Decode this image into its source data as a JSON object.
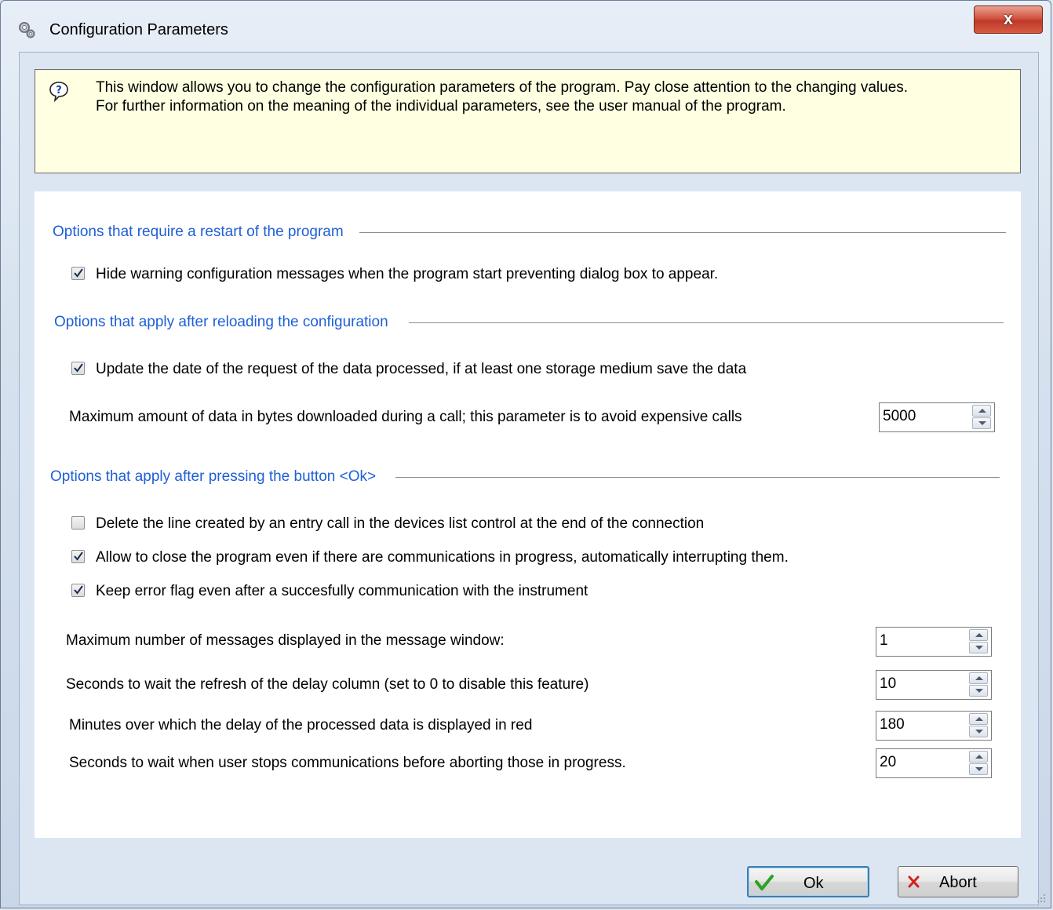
{
  "window": {
    "title": "Configuration Parameters",
    "close_label": "x"
  },
  "info": {
    "text": "This window allows you to change the configuration parameters of the program. Pay close attention to the changing values.\nFor further information on the meaning of the individual parameters, see the user manual of the program."
  },
  "groups": {
    "restart": {
      "title": "Options that require a restart of the program"
    },
    "reload": {
      "title": "Options that apply after reloading the configuration"
    },
    "ok": {
      "title": "Options that apply after pressing the button <Ok>"
    }
  },
  "options": {
    "hide_warnings": {
      "label": "Hide warning configuration  messages when the program start preventing dialog box to appear.",
      "checked": true
    },
    "update_date": {
      "label": "Update the date of the request of the data processed, if at least one storage medium save the data",
      "checked": true
    },
    "max_bytes": {
      "label": "Maximum amount of data in bytes downloaded during a call; this parameter is to avoid expensive calls",
      "value": "5000"
    },
    "delete_line": {
      "label": "Delete the line created by an entry call in the devices list control at the end of the connection",
      "checked": false
    },
    "allow_close": {
      "label": "Allow to close the program even if there are communications in progress, automatically interrupting them.",
      "checked": true
    },
    "keep_error": {
      "label": "Keep error flag even after a succesfully communication with the instrument",
      "checked": true
    },
    "max_messages": {
      "label": "Maximum number of messages displayed in the message window:",
      "value": "1"
    },
    "refresh_delay": {
      "label": "Seconds to wait the refresh of the delay column (set to 0 to disable this feature)",
      "value": "10"
    },
    "delay_red": {
      "label": "Minutes over which the delay of the processed data is displayed in red",
      "value": "180"
    },
    "abort_wait": {
      "label": "Seconds to wait when user stops communications before aborting those in progress.",
      "value": "20"
    }
  },
  "buttons": {
    "ok": "Ok",
    "abort": "Abort"
  }
}
